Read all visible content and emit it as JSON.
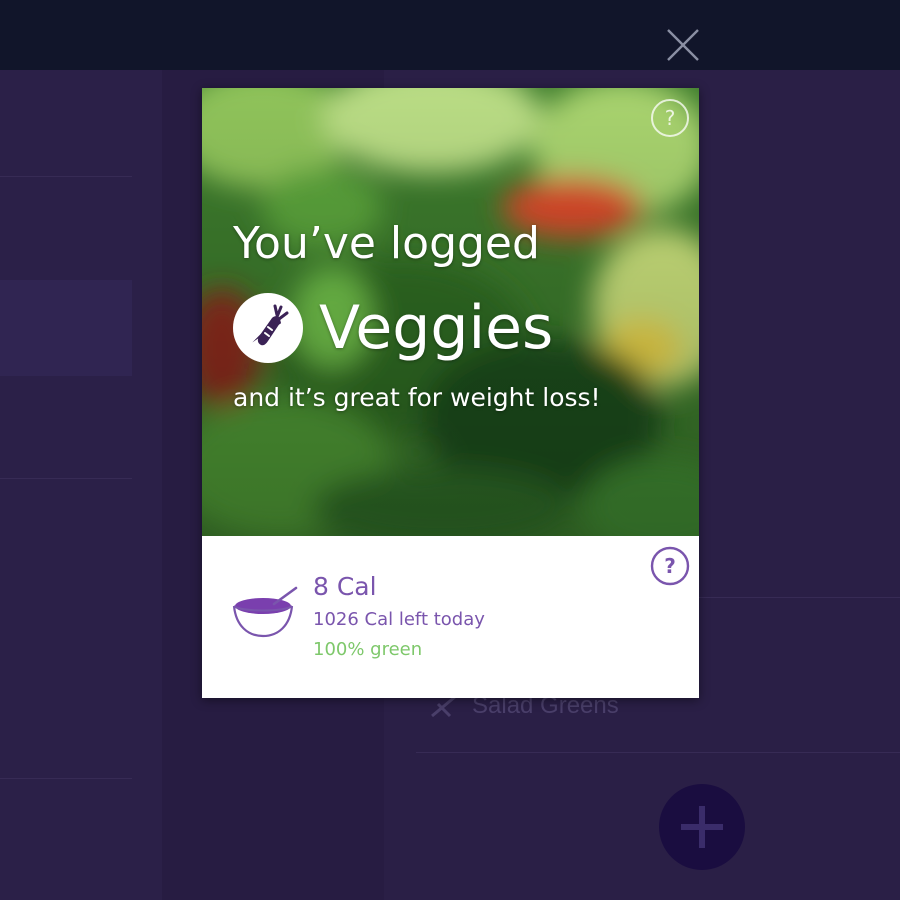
{
  "modal": {
    "headline": "You’ve logged",
    "food_category": "Veggies",
    "message": "and it’s great for weight loss!",
    "calories": "8 Cal",
    "calories_left": "1026 Cal left today",
    "green_percent": "100% green",
    "icons": {
      "close": "close-icon",
      "help": "help-icon",
      "food": "carrot-icon",
      "meal": "bowl-icon"
    }
  },
  "background": {
    "list_item": "Salad Greens",
    "fab_icon": "plus-icon"
  },
  "colors": {
    "accent_purple": "#7a55ad",
    "green": "#7ec86b",
    "app_background": "#2a1f45",
    "top_bar": "#11152a"
  }
}
